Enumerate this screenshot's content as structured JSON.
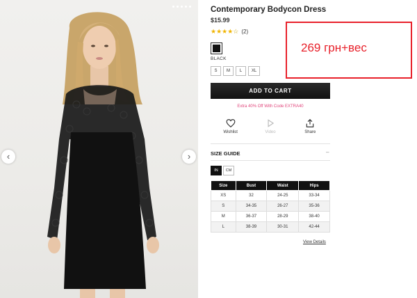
{
  "product": {
    "title": "Contemporary Bodycon Dress",
    "price": "$15.99",
    "rating": {
      "stars": 4,
      "max": 5,
      "count_label": "(2)"
    },
    "color": {
      "name": "BLACK",
      "swatch": "#111111"
    },
    "sizes": [
      "S",
      "M",
      "L",
      "XL"
    ],
    "add_to_cart_label": "ADD TO CART",
    "promo_text": "Extra 40% Off With Code EXTRA40",
    "actions": [
      {
        "label": "Wishlist",
        "icon": "heart-icon"
      },
      {
        "label": "Video",
        "icon": "play-icon"
      },
      {
        "label": "Share",
        "icon": "share-icon"
      }
    ]
  },
  "gallery": {
    "prev_label": "‹",
    "next_label": "›"
  },
  "size_guide": {
    "heading": "SIZE GUIDE",
    "toggle": "–",
    "units": [
      "IN",
      "CM"
    ],
    "active_unit": "IN",
    "columns": [
      "Size",
      "Bust",
      "Waist",
      "Hips"
    ],
    "rows": [
      [
        "XS",
        "32",
        "24-25",
        "33-34"
      ],
      [
        "S",
        "34-35",
        "26-27",
        "35-36"
      ],
      [
        "M",
        "36-37",
        "28-29",
        "38-40"
      ],
      [
        "L",
        "38-39",
        "30-31",
        "42-44"
      ]
    ],
    "view_details_label": "View Details"
  },
  "annotation": {
    "text": "269 грн+вес",
    "color": "#e8202a"
  },
  "colors": {
    "promo": "#e0457b",
    "star": "#f0b400"
  }
}
